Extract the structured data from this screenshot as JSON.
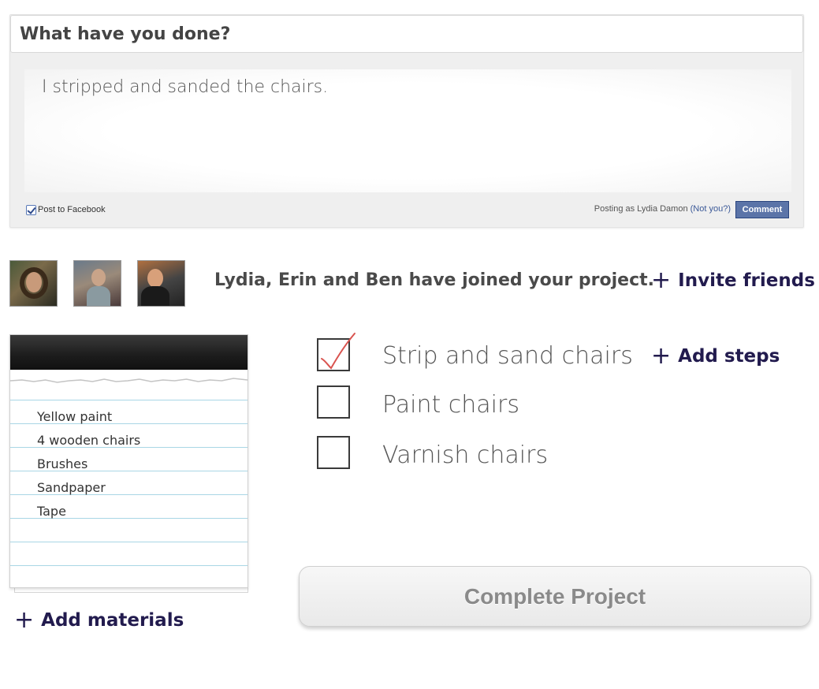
{
  "comment": {
    "header": "What have you done?",
    "text": "I stripped and sanded the chairs.",
    "post_to_facebook": "Post to Facebook",
    "post_to_facebook_checked": true,
    "posting_as": "Posting as Lydia Damon",
    "not_you": "(Not you?)",
    "comment_button": "Comment"
  },
  "collaborators": {
    "joined_text": "Lydia, Erin and Ben have joined your project.",
    "invite_label": "Invite friends"
  },
  "materials": {
    "items": [
      "Yellow paint",
      "4 wooden chairs",
      "Brushes",
      "Sandpaper",
      "Tape"
    ],
    "add_label": "Add materials"
  },
  "steps": {
    "items": [
      {
        "label": "Strip and sand chairs",
        "checked": true
      },
      {
        "label": "Paint chairs",
        "checked": false
      },
      {
        "label": "Varnish chairs",
        "checked": false
      }
    ],
    "add_label": "Add steps"
  },
  "complete_button": "Complete Project",
  "colors": {
    "link": "#221b4e",
    "facebook_blue": "#5b74a8",
    "check_red": "#d9534f"
  },
  "icons": [
    "plus-icon",
    "checkmark-icon"
  ]
}
